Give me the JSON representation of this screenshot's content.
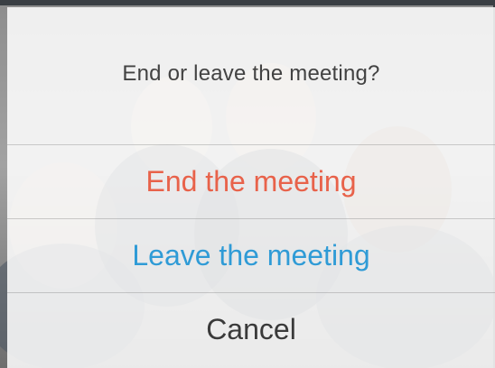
{
  "dialog": {
    "title": "End or leave the meeting?",
    "options": [
      {
        "label": "End the meeting"
      },
      {
        "label": "Leave the meeting"
      },
      {
        "label": "Cancel"
      }
    ]
  },
  "colors": {
    "end_option": "#e8624a",
    "leave_option": "#2f9bd6",
    "cancel_option": "#3a3a3a",
    "title": "#424242"
  },
  "background": {
    "description_icon": "group-photo-background"
  }
}
